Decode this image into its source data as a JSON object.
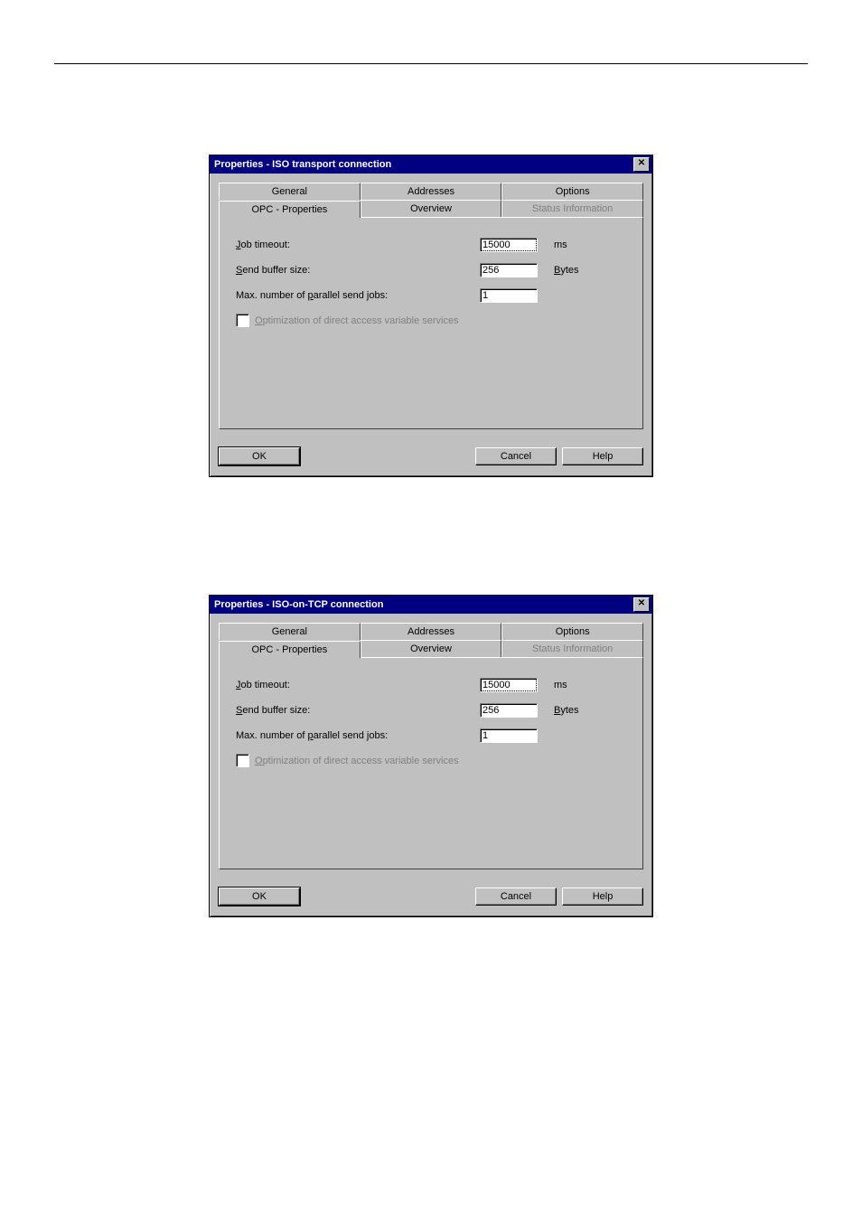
{
  "dialogs": [
    {
      "title": "Properties - ISO transport connection",
      "tabs_row1": [
        {
          "label": "General",
          "active": false,
          "disabled": false
        },
        {
          "label": "Addresses",
          "active": false,
          "disabled": false
        },
        {
          "label": "Options",
          "active": false,
          "disabled": false
        }
      ],
      "tabs_row2": [
        {
          "label": "OPC - Properties",
          "active": true,
          "disabled": false
        },
        {
          "label": "Overview",
          "active": false,
          "disabled": false
        },
        {
          "label": "Status Information",
          "active": false,
          "disabled": true
        }
      ],
      "fields": {
        "job_timeout": {
          "label_pre": "J",
          "label_u": "J",
          "label_rest": "ob timeout:",
          "value": "15000",
          "unit_u": "",
          "unit": "ms"
        },
        "send_buffer": {
          "label_u": "S",
          "label_rest": "end buffer size:",
          "value": "256",
          "unit_u": "B",
          "unit_rest": "ytes"
        },
        "parallel": {
          "label_pre": "Max. number of ",
          "label_u": "p",
          "label_rest": "arallel send jobs:",
          "value": "1"
        },
        "optimization": {
          "label_u": "O",
          "label_rest": "ptimization of direct access variable services",
          "checked": false
        }
      },
      "buttons": {
        "ok": "OK",
        "cancel": "Cancel",
        "help": "Help"
      }
    },
    {
      "title": "Properties - ISO-on-TCP connection",
      "tabs_row1": [
        {
          "label": "General",
          "active": false,
          "disabled": false
        },
        {
          "label": "Addresses",
          "active": false,
          "disabled": false
        },
        {
          "label": "Options",
          "active": false,
          "disabled": false
        }
      ],
      "tabs_row2": [
        {
          "label": "OPC - Properties",
          "active": true,
          "disabled": false
        },
        {
          "label": "Overview",
          "active": false,
          "disabled": false
        },
        {
          "label": "Status Information",
          "active": false,
          "disabled": true
        }
      ],
      "fields": {
        "job_timeout": {
          "label_u": "J",
          "label_rest": "ob timeout:",
          "value": "15000",
          "unit": "ms"
        },
        "send_buffer": {
          "label_u": "S",
          "label_rest": "end buffer size:",
          "value": "256",
          "unit_u": "B",
          "unit_rest": "ytes"
        },
        "parallel": {
          "label_pre": "Max. number of ",
          "label_u": "p",
          "label_rest": "arallel send jobs:",
          "value": "1"
        },
        "optimization": {
          "label_u": "O",
          "label_rest": "ptimization of direct access variable services",
          "checked": false
        }
      },
      "buttons": {
        "ok": "OK",
        "cancel": "Cancel",
        "help": "Help"
      }
    }
  ]
}
